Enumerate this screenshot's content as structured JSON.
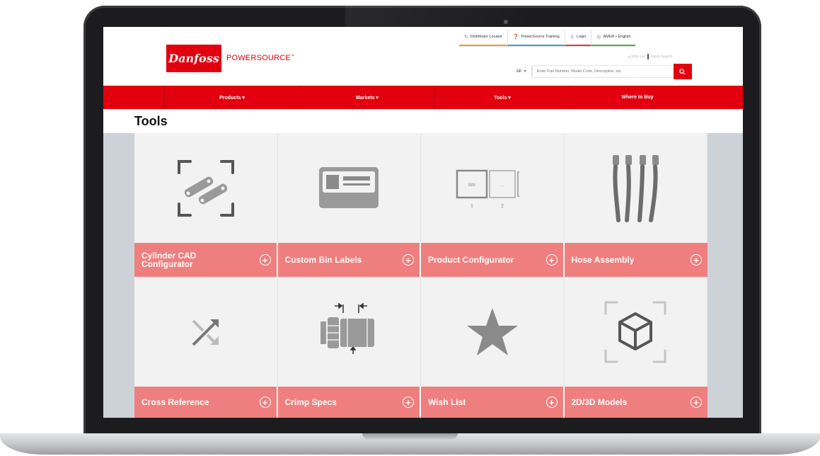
{
  "brand": {
    "logo_text": "Danfoss",
    "name_part1": "POWER",
    "name_part2": "SOURCE",
    "trademark": "™"
  },
  "utility_nav": {
    "distributor_locator": "Distributor Locator",
    "training": "PowerSource Training",
    "login": "Login",
    "region": "AMER • English",
    "wish_list": "♦ Wish List",
    "batch_search": "Batch Search"
  },
  "search": {
    "scope": "All",
    "placeholder": "Enter Part Number, Model Code, Description, etc."
  },
  "main_nav": [
    {
      "label": "Products ▾"
    },
    {
      "label": "Markets ▾"
    },
    {
      "label": "Tools ▾"
    },
    {
      "label": "Where to Buy"
    }
  ],
  "page": {
    "title": "Tools"
  },
  "tools": [
    {
      "label": "Cylinder CAD Configurator",
      "icon": "cylinder-cad-icon"
    },
    {
      "label": "Custom Bin Labels",
      "icon": "bin-label-icon"
    },
    {
      "label": "Product Configurator",
      "icon": "configurator-icon"
    },
    {
      "label": "Hose Assembly",
      "icon": "hose-assembly-icon"
    },
    {
      "label": "Cross Reference",
      "icon": "cross-reference-icon"
    },
    {
      "label": "Crimp Specs",
      "icon": "crimp-specs-icon"
    },
    {
      "label": "Wish List",
      "icon": "star-icon"
    },
    {
      "label": "2D/3D Models",
      "icon": "cube-icon"
    }
  ],
  "configurator_icon_text": {
    "box1": "BIN",
    "box2": "...",
    "step1": "1",
    "step2": "2"
  },
  "colors": {
    "brand_red": "#e2000f",
    "tile_label": "#ef7f7f",
    "tile_bg": "#f2f2f2",
    "icon_gray": "#8a8a8a"
  }
}
